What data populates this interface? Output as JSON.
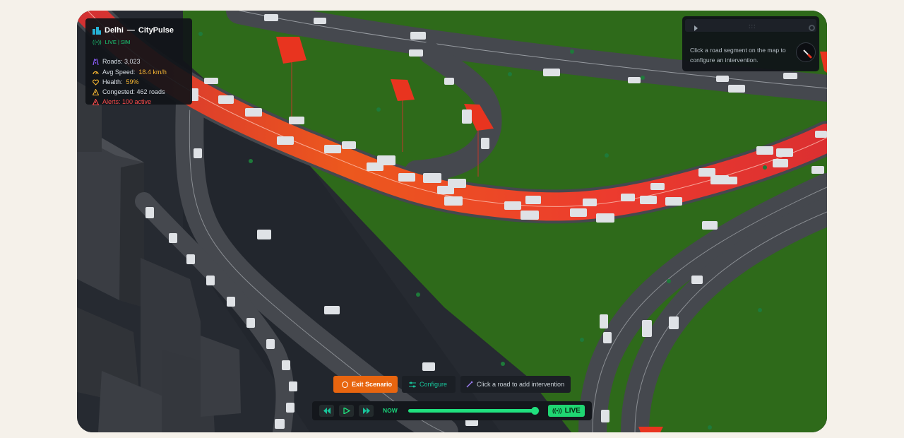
{
  "app": {
    "city": "Delhi",
    "separator": "—",
    "name": "CityPulse",
    "mode": "LIVE | SIM"
  },
  "stats": {
    "roads": "Roads: 3,023",
    "avg_speed_label": "Avg Speed:",
    "avg_speed_value": "18.4 km/h",
    "health_label": "Health:",
    "health_value": "59%",
    "congested": "Congested: 462 roads",
    "alerts": "Alerts: 100 active"
  },
  "config_panel": {
    "message": "Click a road segment on the map to configure an intervention.",
    "handle": ":::"
  },
  "toolbar": {
    "exit_label": "Exit Scenario",
    "configure_label": "Configure",
    "hint": "Click a road to add intervention"
  },
  "timeline": {
    "now_label": "NOW",
    "live_label": "LIVE",
    "progress": 0.97
  },
  "colors": {
    "accent_green": "#1fd672",
    "accent_orange": "#e8650f",
    "grass": "#2e6a1a",
    "asphalt": "#262a31",
    "road": "#45484e",
    "congestion": "#ff3b2b",
    "speed": "#f5b533",
    "alert": "#ff4d4d"
  },
  "icons": {
    "city": "city-icon",
    "live": "broadcast-icon",
    "roads": "road-icon",
    "speed": "gauge-icon",
    "health": "heart-icon",
    "congested": "warning-icon",
    "alerts": "alert-icon",
    "brush": "paintbrush-icon"
  }
}
